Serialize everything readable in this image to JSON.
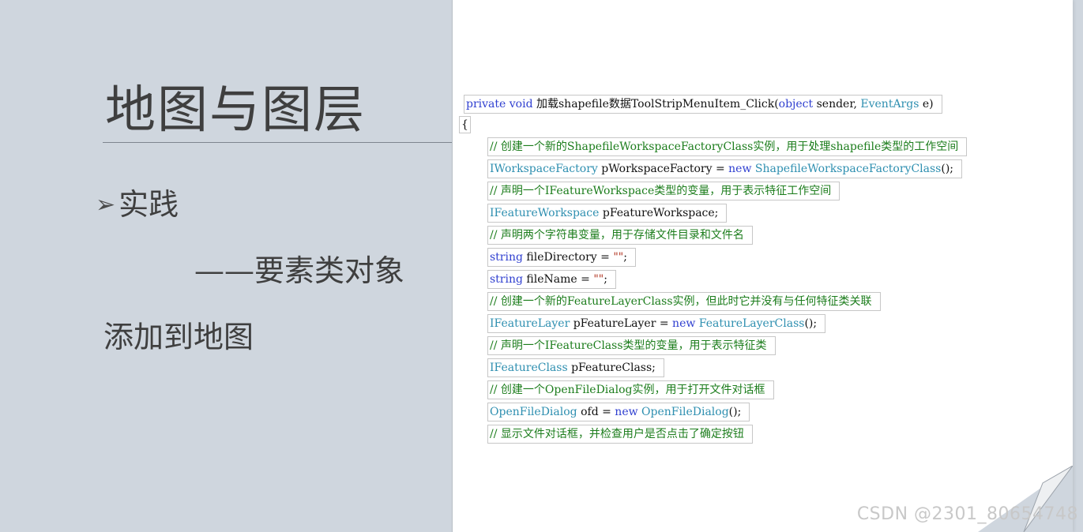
{
  "slide": {
    "title": "地图与图层",
    "bullet_arrow": "➢",
    "bullet_text": "实践",
    "sub_text": "——要素类对象",
    "add_text": "添加到地图"
  },
  "code": {
    "signature": {
      "kw1": "private",
      "kw2": "void",
      "name": "加载shapefile数据ToolStripMenuItem_Click(",
      "param1_type": "object",
      "param1_name": "sender,",
      "param2_type": "EventArgs",
      "param2_name": "e)"
    },
    "open_brace": "{",
    "comment1": "// 创建一个新的ShapefileWorkspaceFactoryClass实例，用于处理shapefile类型的工作空间",
    "line2": {
      "type": "IWorkspaceFactory",
      "mid": "pWorkspaceFactory =",
      "kw": "new",
      "cls": "ShapefileWorkspaceFactoryClass",
      "end": "();"
    },
    "comment2": "// 声明一个IFeatureWorkspace类型的变量，用于表示特征工作空间",
    "line4": {
      "type": "IFeatureWorkspace",
      "mid": "pFeatureWorkspace;"
    },
    "comment3": "// 声明两个字符串变量，用于存储文件目录和文件名",
    "line6": {
      "kw": "string",
      "mid": "fileDirectory =",
      "str": "\"\"",
      "end": ";"
    },
    "line7": {
      "kw": "string",
      "mid": "fileName =",
      "str": "\"\"",
      "end": ";"
    },
    "comment4": "// 创建一个新的FeatureLayerClass实例，但此时它并没有与任何特征类关联",
    "line9": {
      "type": "IFeatureLayer",
      "mid": "pFeatureLayer =",
      "kw": "new",
      "cls": "FeatureLayerClass",
      "end": "();"
    },
    "comment5": "// 声明一个IFeatureClass类型的变量，用于表示特征类",
    "line11": {
      "type": "IFeatureClass",
      "mid": "pFeatureClass;"
    },
    "comment6": "// 创建一个OpenFileDialog实例，用于打开文件对话框",
    "line13": {
      "type": "OpenFileDialog",
      "mid": "ofd =",
      "kw": "new",
      "cls": "OpenFileDialog",
      "end": "();"
    },
    "comment7": "// 显示文件对话框，并检查用户是否点击了确定按钮"
  },
  "watermark": "CSDN @2301_80654748",
  "colors": {
    "keyword": "#2f3fd0",
    "type": "#2e8fb0",
    "comment": "#1c7d1c",
    "string": "#b0311d",
    "slide_bg": "#cfd6de"
  }
}
